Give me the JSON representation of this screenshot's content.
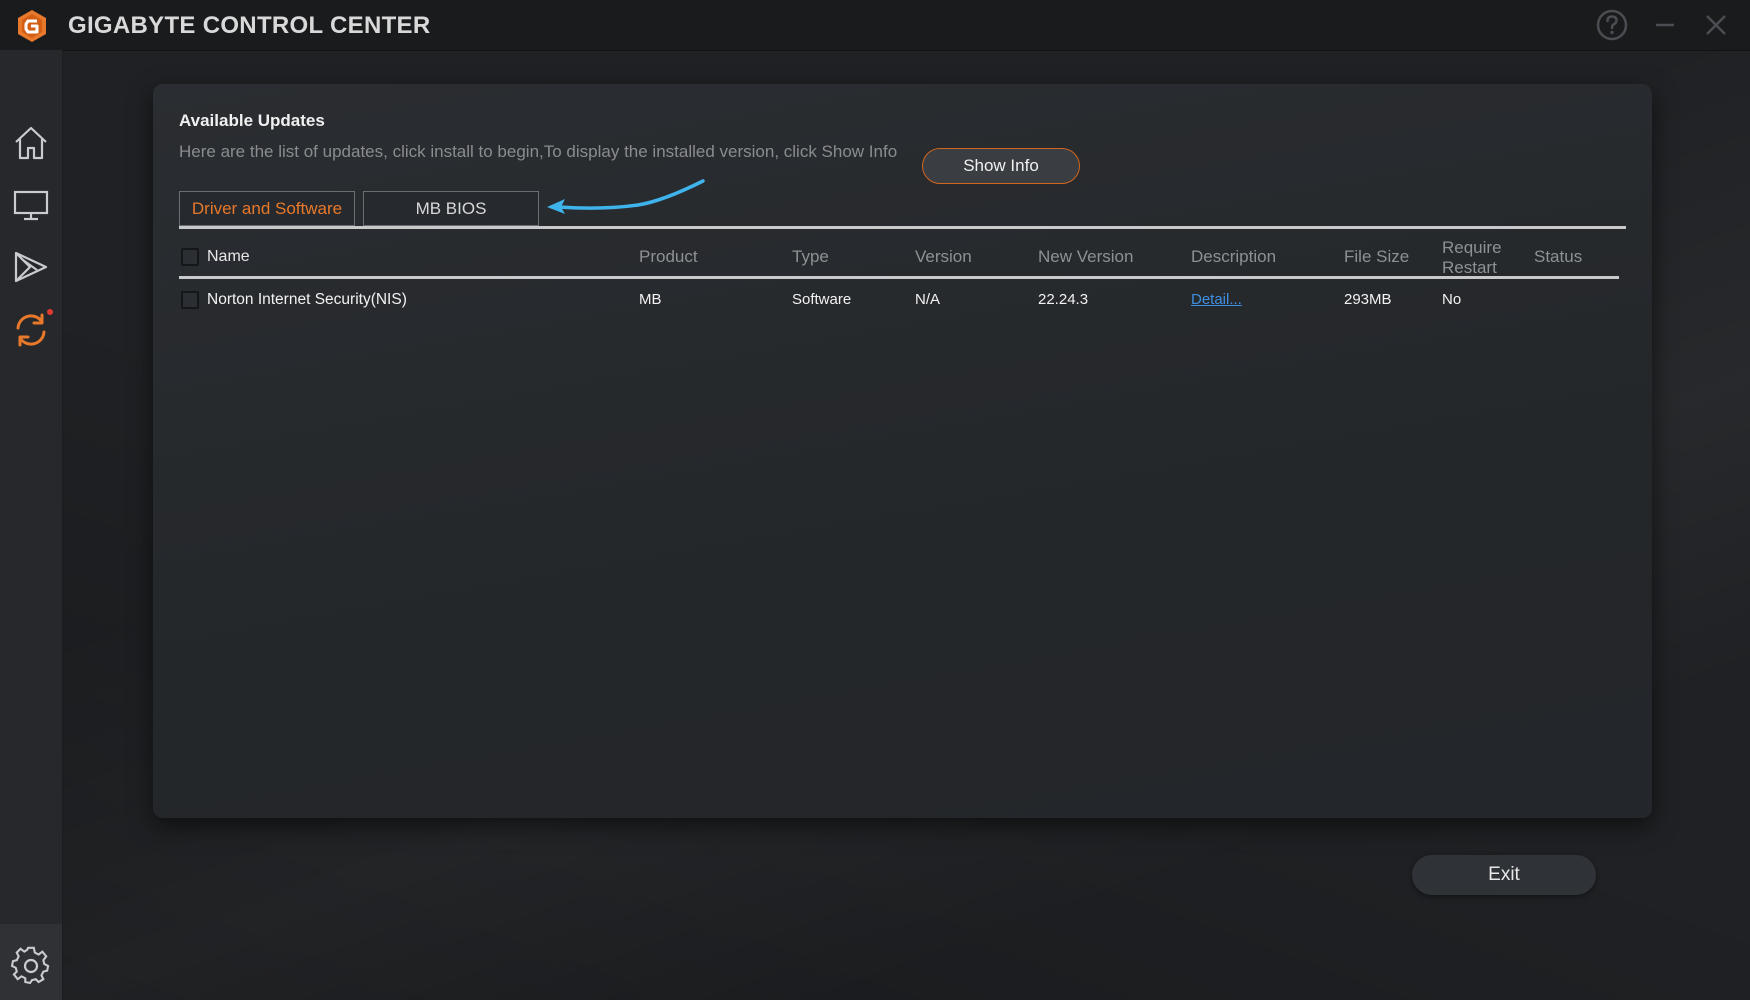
{
  "window": {
    "title": "GIGABYTE CONTROL CENTER",
    "accent_color": "#e8782a",
    "controls": [
      "help-icon",
      "minimize-icon",
      "close-icon"
    ]
  },
  "sidebar": {
    "items": [
      {
        "name": "home",
        "icon": "home-icon"
      },
      {
        "name": "monitor",
        "icon": "monitor-icon"
      },
      {
        "name": "apps",
        "icon": "apps-icon"
      },
      {
        "name": "update",
        "icon": "update-icon",
        "active": true,
        "notification": true
      },
      {
        "name": "settings",
        "icon": "gear-icon"
      }
    ]
  },
  "panel": {
    "title": "Available Updates",
    "subtitle": "Here are the list of updates, click install to begin,To display the installed version, click Show Info",
    "show_info_label": "Show Info",
    "tabs": [
      {
        "label": "Driver and Software",
        "active": true
      },
      {
        "label": "MB BIOS",
        "active": false
      }
    ]
  },
  "table": {
    "headers": {
      "name": "Name",
      "product": "Product",
      "type": "Type",
      "version": "Version",
      "new_version": "New Version",
      "description": "Description",
      "file_size": "File Size",
      "require_restart_1": "Require",
      "require_restart_2": "Restart",
      "status": "Status"
    },
    "rows": [
      {
        "checked": false,
        "name": "Norton Internet Security(NIS)",
        "product": "MB",
        "type": "Software",
        "version": "N/A",
        "new_version": "22.24.3",
        "description": "Detail...",
        "file_size": "293MB",
        "require_restart": "No",
        "status": ""
      }
    ]
  },
  "footer": {
    "exit_label": "Exit"
  }
}
